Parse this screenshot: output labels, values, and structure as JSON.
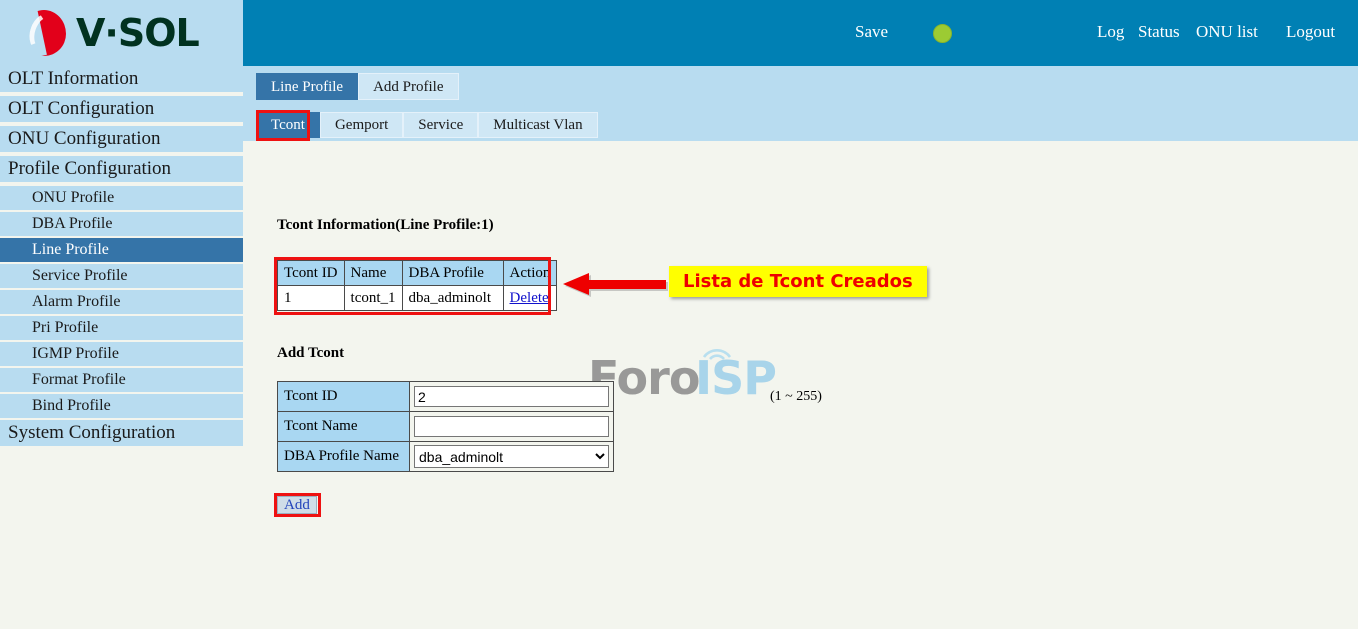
{
  "brand": {
    "name": "V·SOL",
    "logo_icon": "vsol-flame-logo"
  },
  "header": {
    "links": [
      {
        "label": "Save",
        "name": "save-link"
      },
      {
        "label": "Log",
        "name": "log-link"
      },
      {
        "label": "Status",
        "name": "status-link"
      },
      {
        "label": "ONU list",
        "name": "onu-list-link"
      },
      {
        "label": "Logout",
        "name": "logout-link"
      }
    ],
    "status_indicator": {
      "name": "status-indicator-dot",
      "color": "#9ccb33"
    },
    "bar_color": "#0080b4"
  },
  "sidebar": {
    "items": [
      {
        "label": "OLT Information",
        "level": "top",
        "active": false
      },
      {
        "label": "OLT Configuration",
        "level": "top",
        "active": false
      },
      {
        "label": "ONU Configuration",
        "level": "top",
        "active": false
      },
      {
        "label": "Profile Configuration",
        "level": "top",
        "active": false
      },
      {
        "label": "ONU Profile",
        "level": "sub",
        "active": false
      },
      {
        "label": "DBA Profile",
        "level": "sub",
        "active": false
      },
      {
        "label": "Line Profile",
        "level": "sub",
        "active": true
      },
      {
        "label": "Service Profile",
        "level": "sub",
        "active": false
      },
      {
        "label": "Alarm Profile",
        "level": "sub",
        "active": false
      },
      {
        "label": "Pri Profile",
        "level": "sub",
        "active": false
      },
      {
        "label": "IGMP Profile",
        "level": "sub",
        "active": false
      },
      {
        "label": "Format Profile",
        "level": "sub",
        "active": false
      },
      {
        "label": "Bind Profile",
        "level": "sub",
        "active": false
      },
      {
        "label": "System Configuration",
        "level": "top",
        "active": false
      }
    ]
  },
  "tabs": {
    "primary": [
      {
        "label": "Line Profile",
        "selected": true
      },
      {
        "label": "Add Profile",
        "selected": false
      }
    ],
    "secondary": [
      {
        "label": "Tcont",
        "selected": true
      },
      {
        "label": "Gemport",
        "selected": false
      },
      {
        "label": "Service",
        "selected": false
      },
      {
        "label": "Multicast Vlan",
        "selected": false
      }
    ]
  },
  "content": {
    "info_title": "Tcont Information(Line Profile:1)",
    "add_title": "Add Tcont",
    "table": {
      "columns": [
        "Tcont ID",
        "Name",
        "DBA Profile",
        "Action"
      ],
      "rows": [
        {
          "id": "1",
          "name": "tcont_1",
          "dba_profile": "dba_adminolt",
          "action": "Delete"
        }
      ]
    },
    "form": {
      "tcont_id_label": "Tcont ID",
      "tcont_id_value": "2",
      "tcont_id_range": "(1 ~ 255)",
      "tcont_name_label": "Tcont Name",
      "tcont_name_value": "",
      "tcont_name_placeholder": "",
      "dba_profile_label": "DBA Profile Name",
      "dba_profile_value": "dba_adminolt",
      "dba_profile_options": [
        "dba_adminolt"
      ],
      "add_button": "Add"
    }
  },
  "annotations": {
    "callout_text": "Lista de Tcont Creados",
    "callout_bg": "#ffff00",
    "callout_fg": "#ee0000",
    "highlight_color": "#ee1111",
    "arrow_name": "red-left-arrow"
  },
  "watermark": {
    "text_left": "Foro",
    "text_right": "ISP",
    "icon": "signal-tower-icon"
  }
}
